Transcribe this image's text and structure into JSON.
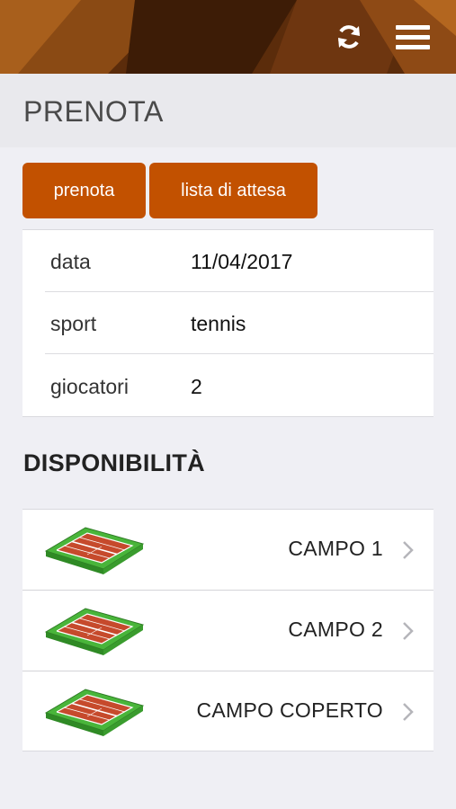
{
  "header": {
    "refresh_icon": "refresh-icon",
    "menu_icon": "hamburger-menu-icon",
    "colors": {
      "background": "#5a2d0c",
      "accent": "#c25100"
    }
  },
  "page": {
    "title": "PRENOTA"
  },
  "actions": {
    "book_label": "prenota",
    "waitlist_label": "lista di attesa"
  },
  "form": {
    "rows": [
      {
        "label": "data",
        "value": "11/04/2017"
      },
      {
        "label": "sport",
        "value": "tennis"
      },
      {
        "label": "giocatori",
        "value": "2"
      }
    ]
  },
  "availability": {
    "title": "DISPONIBILITÀ",
    "courts": [
      {
        "name": "CAMPO 1",
        "icon": "tennis-court-icon"
      },
      {
        "name": "CAMPO 2",
        "icon": "tennis-court-icon"
      },
      {
        "name": "CAMPO COPERTO",
        "icon": "tennis-court-icon"
      }
    ]
  }
}
